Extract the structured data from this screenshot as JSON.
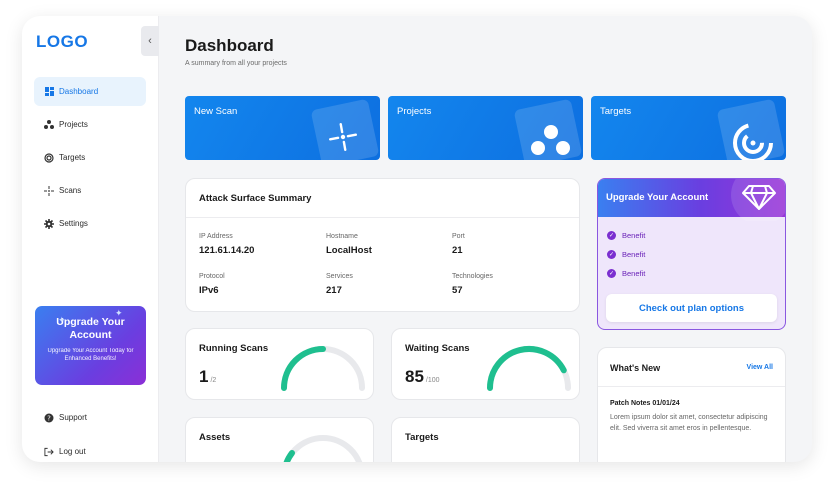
{
  "brand": {
    "logo": "LOGO"
  },
  "sidebar": {
    "items": [
      {
        "label": "Dashboard",
        "icon": "grid-icon",
        "active": true
      },
      {
        "label": "Projects",
        "icon": "projects-icon",
        "active": false
      },
      {
        "label": "Targets",
        "icon": "target-icon",
        "active": false
      },
      {
        "label": "Scans",
        "icon": "crosshair-icon",
        "active": false
      },
      {
        "label": "Settings",
        "icon": "gear-icon",
        "active": false
      }
    ],
    "upgrade": {
      "title": "Upgrade Your Account",
      "subtitle": "Upgrade Your Account Today for Enhanced Benefits!"
    },
    "support": "Support",
    "logout": "Log out"
  },
  "header": {
    "title": "Dashboard",
    "subtitle": "A summary from all your projects"
  },
  "tiles": [
    {
      "label": "New Scan",
      "icon": "crosshair-icon"
    },
    {
      "label": "Projects",
      "icon": "projects-icon"
    },
    {
      "label": "Targets",
      "icon": "target-icon"
    }
  ],
  "attack_surface": {
    "title": "Attack Surface Summary",
    "fields": [
      {
        "label": "IP Address",
        "value": "121.61.14.20"
      },
      {
        "label": "Hostname",
        "value": "LocalHost"
      },
      {
        "label": "Port",
        "value": "21"
      },
      {
        "label": "Protocol",
        "value": "IPv6"
      },
      {
        "label": "Services",
        "value": "217"
      },
      {
        "label": "Technologies",
        "value": "57"
      }
    ]
  },
  "upgrade_card": {
    "title": "Upgrade Your Account",
    "benefits": [
      "Benefit",
      "Benefit",
      "Benefit"
    ],
    "cta": "Check out plan options"
  },
  "running_scans": {
    "title": "Running Scans",
    "value": "1",
    "total": "/2",
    "fraction": 0.5
  },
  "waiting_scans": {
    "title": "Waiting Scans",
    "value": "85",
    "total": "/100",
    "fraction": 0.85
  },
  "assets": {
    "title": "Assets"
  },
  "targets": {
    "title": "Targets"
  },
  "whats_new": {
    "title": "What's New",
    "view_all": "View All",
    "note_title": "Patch Notes 01/01/24",
    "note_body": "Lorem ipsum dolor sit amet, consectetur adipiscing elit. Sed viverra sit amet eros in pellentesque."
  },
  "colors": {
    "primary": "#1677e6",
    "gauge": "#1fbf8f",
    "purple": "#7b2fd0"
  }
}
